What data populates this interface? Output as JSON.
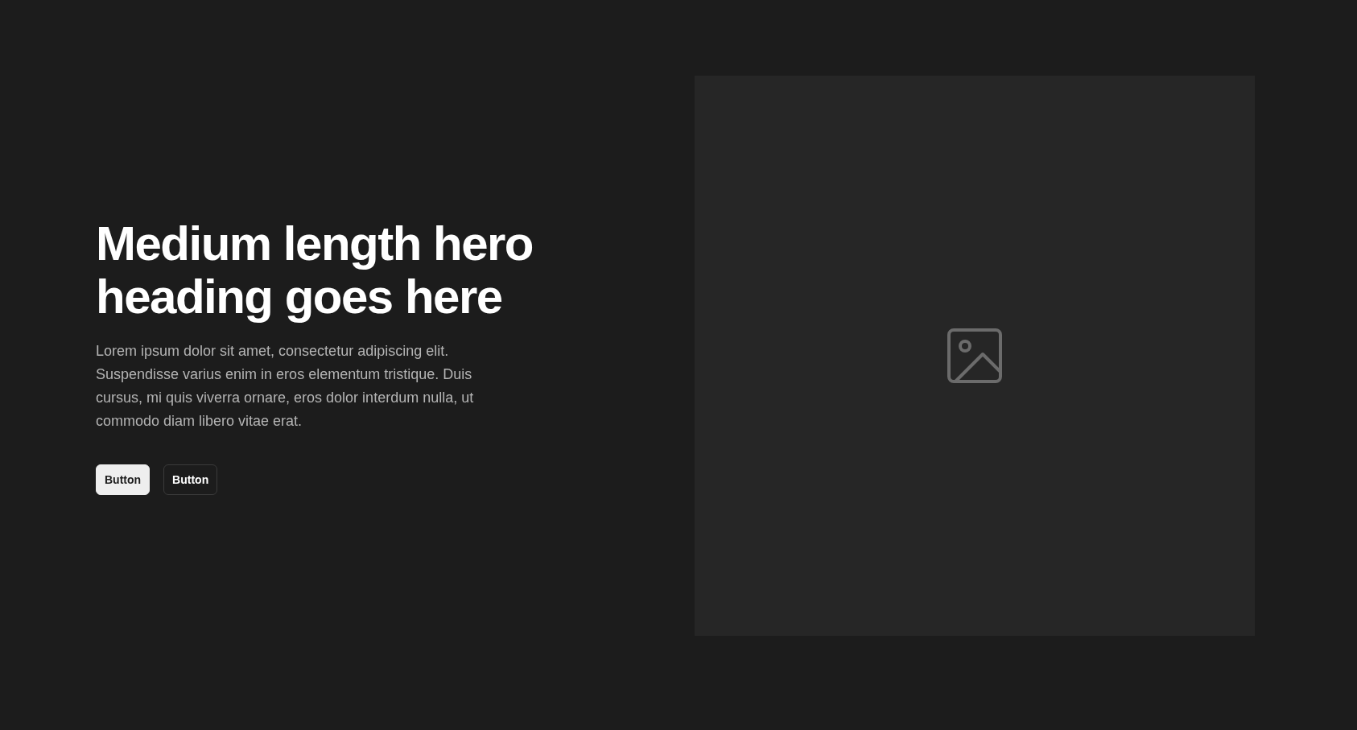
{
  "hero": {
    "heading": "Medium length hero heading goes here",
    "paragraph": "Lorem ipsum dolor sit amet, consectetur adipiscing elit. Suspendisse varius enim in eros elementum tristique. Duis cursus, mi quis viverra ornare, eros dolor interdum nulla, ut commodo diam libero vitae erat.",
    "buttons": [
      {
        "label": "Button",
        "kind": "primary"
      },
      {
        "label": "Button",
        "kind": "secondary"
      }
    ]
  }
}
